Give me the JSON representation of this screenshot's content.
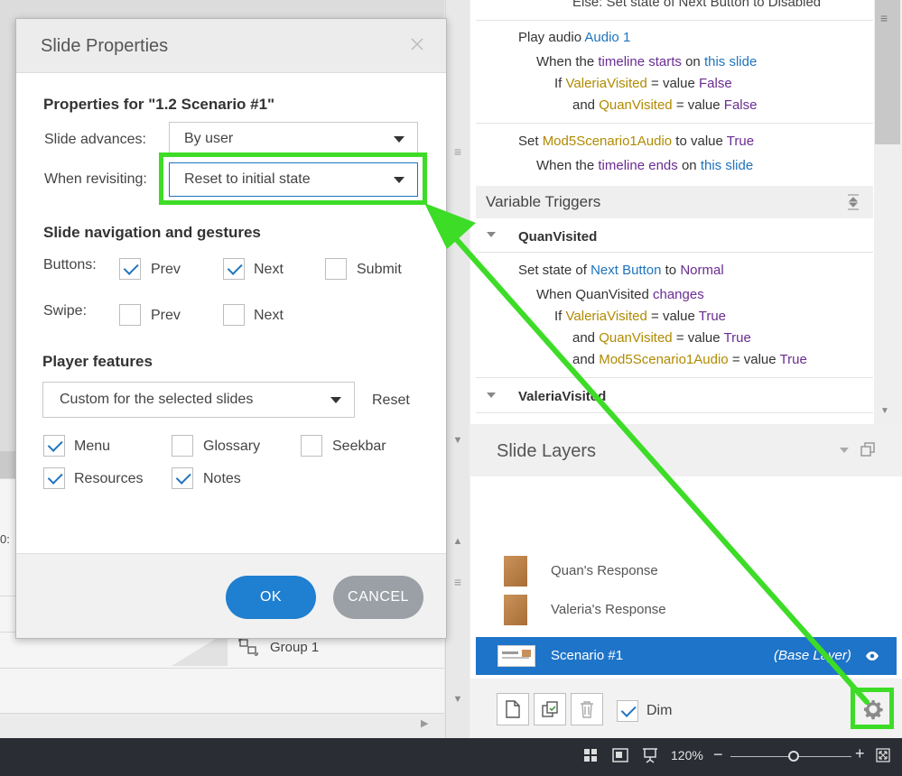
{
  "dialog": {
    "title": "Slide Properties",
    "close_icon": "close-icon",
    "properties_for": "Properties for \"1.2 Scenario #1\"",
    "slide_advances_label": "Slide advances:",
    "slide_advances_value": "By user",
    "when_revisiting_label": "When revisiting:",
    "when_revisiting_value": "Reset to initial state",
    "nav_section": "Slide navigation and gestures",
    "buttons_label": "Buttons:",
    "swipe_label": "Swipe:",
    "buttons": [
      {
        "label": "Prev",
        "checked": true
      },
      {
        "label": "Next",
        "checked": true
      },
      {
        "label": "Submit",
        "checked": false
      }
    ],
    "swipe": [
      {
        "label": "Prev",
        "checked": false
      },
      {
        "label": "Next",
        "checked": false
      }
    ],
    "player_section": "Player features",
    "player_select": "Custom for the selected slides",
    "reset_label": "Reset",
    "features": [
      {
        "label": "Menu",
        "checked": true
      },
      {
        "label": "Glossary",
        "checked": false
      },
      {
        "label": "Seekbar",
        "checked": false
      },
      {
        "label": "Resources",
        "checked": true
      },
      {
        "label": "Notes",
        "checked": true
      }
    ],
    "ok_label": "OK",
    "cancel_label": "CANCEL"
  },
  "triggers": {
    "partial_top": "Else: Set state of Next Button to Disabled",
    "t1": {
      "action": "Play audio",
      "target": "Audio 1",
      "when": "When the",
      "event": "timeline starts",
      "on": "on",
      "obj": "this slide",
      "if": "If",
      "var1": "ValeriaVisited",
      "eq": "= value",
      "val1": "False",
      "and": "and",
      "var2": "QuanVisited",
      "val2": "False"
    },
    "t2": {
      "action": "Set",
      "var": "Mod5Scenario1Audio",
      "to": "to value",
      "val": "True",
      "when": "When the",
      "event": "timeline ends",
      "on": "on",
      "obj": "this slide"
    },
    "variable_triggers_header": "Variable Triggers",
    "group1": "QuanVisited",
    "t3": {
      "action": "Set state of",
      "target": "Next Button",
      "to": "to",
      "state": "Normal",
      "when": "When QuanVisited",
      "changes": "changes",
      "if": "If",
      "var1": "ValeriaVisited",
      "eq": "= value",
      "val1": "True",
      "and": "and",
      "var2": "QuanVisited",
      "val2": "True",
      "var3": "Mod5Scenario1Audio",
      "val3": "True"
    },
    "group2": "ValeriaVisited"
  },
  "layers": {
    "title": "Slide Layers",
    "items": [
      {
        "name": "Quan's Response"
      },
      {
        "name": "Valeria's Response"
      }
    ],
    "base_name": "Scenario #1",
    "base_tag": "(Base Layer)",
    "dim_label": "Dim",
    "dim_checked": true
  },
  "left": {
    "time_fragment": "0:",
    "group_label": "Group 1"
  },
  "status": {
    "zoom": "120%",
    "minus": "−",
    "plus": "+",
    "zoom_fraction": 0.52
  },
  "colors": {
    "accent": "#1e73be",
    "highlight": "#3ddc27",
    "ok": "#1f7fd0",
    "cancel": "#9aa0a6"
  }
}
